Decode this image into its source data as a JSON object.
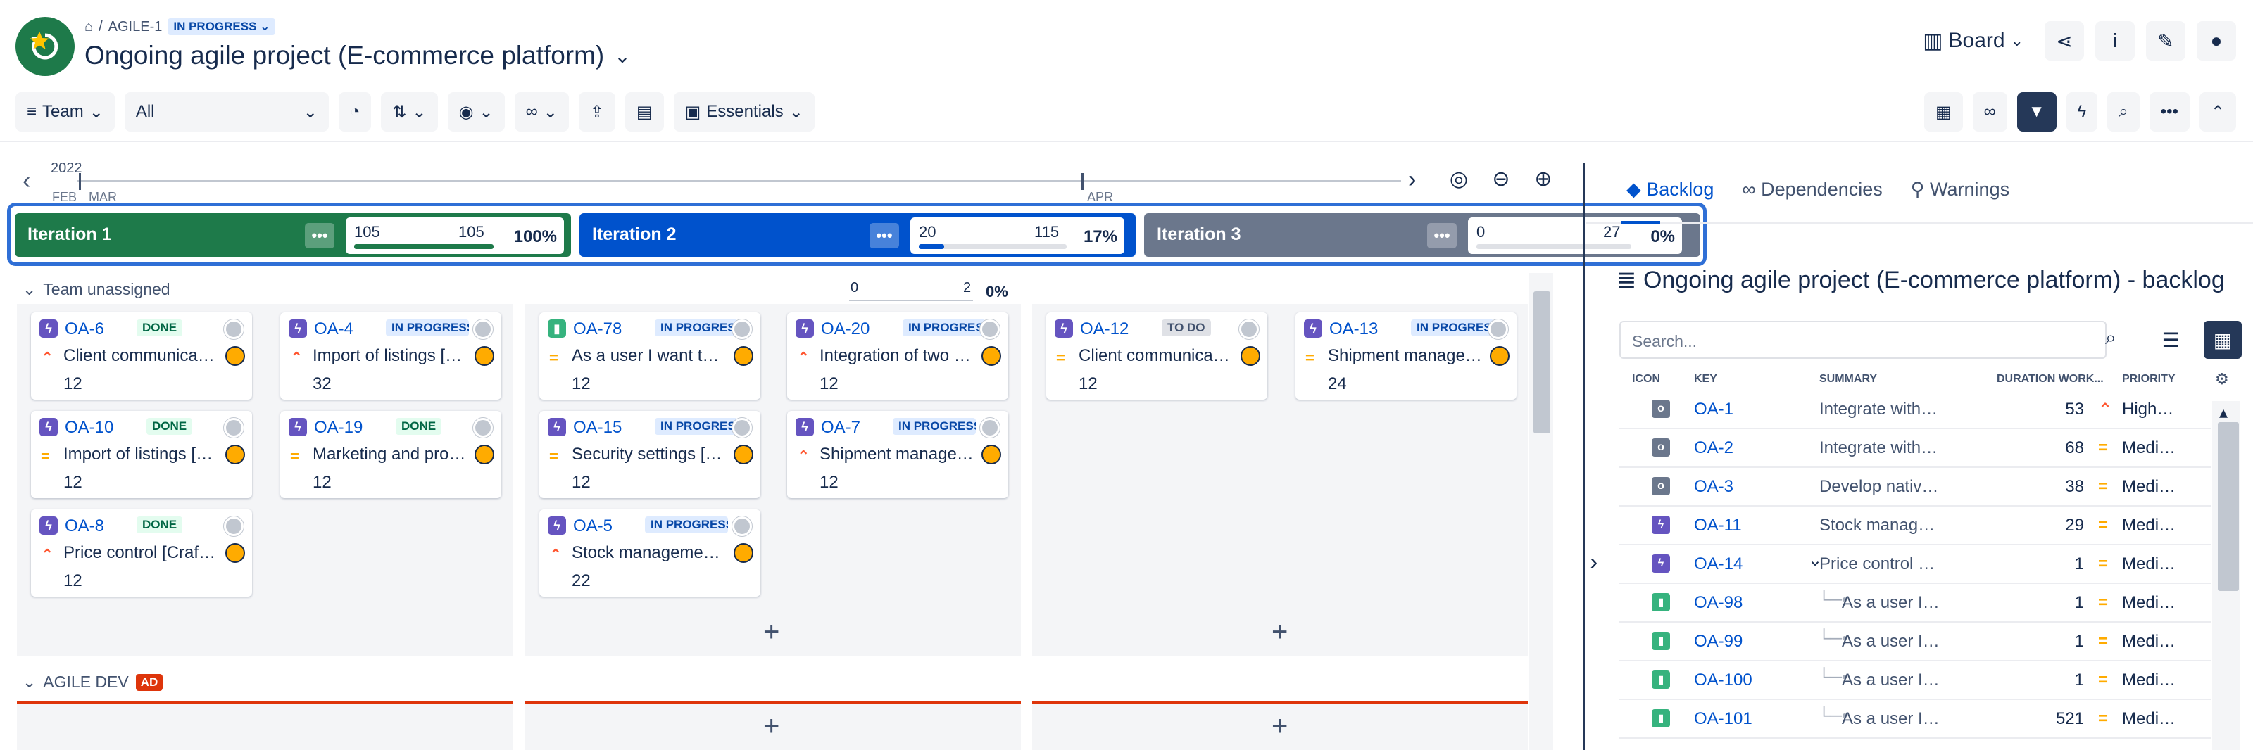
{
  "header": {
    "crumb_project": "AGILE-1",
    "status": "IN PROGRESS",
    "title": "Ongoing agile project (E-commerce platform)",
    "view_label": "Board"
  },
  "toolbar": {
    "team_label": "Team",
    "filter_value": "All",
    "essentials_label": "Essentials"
  },
  "timeline": {
    "year": "2022",
    "months": [
      "FEB",
      "MAR",
      "APR"
    ]
  },
  "iterations": [
    {
      "name": "Iteration 1",
      "done": "105",
      "total": "105",
      "percent": "100%",
      "progress": 1.0,
      "color": "#1e7a4a"
    },
    {
      "name": "Iteration 2",
      "done": "20",
      "total": "115",
      "percent": "17%",
      "progress": 0.17,
      "color": "#0052cc"
    },
    {
      "name": "Iteration 3",
      "done": "0",
      "total": "27",
      "percent": "0%",
      "progress": 0.0,
      "color": "#6b778c"
    }
  ],
  "groups": {
    "unassigned": {
      "name": "Team unassigned",
      "done": "0",
      "total": "2",
      "percent": "0%"
    },
    "agile_dev": {
      "name": "AGILE DEV",
      "badge": "AD"
    }
  },
  "cards": [
    {
      "key": "OA-6",
      "status": "DONE",
      "summary": "Client communicatio…",
      "estimate": "12",
      "priority": "high",
      "type": "story"
    },
    {
      "key": "OA-4",
      "status": "IN PROGRESS",
      "summary": "Import of listings [Cr…",
      "estimate": "32",
      "priority": "high",
      "type": "story"
    },
    {
      "key": "OA-10",
      "status": "DONE",
      "summary": "Import of listings [T…",
      "estimate": "12",
      "priority": "med",
      "type": "story"
    },
    {
      "key": "OA-19",
      "status": "DONE",
      "summary": "Marketing and prom…",
      "estimate": "12",
      "priority": "med",
      "type": "story"
    },
    {
      "key": "OA-8",
      "status": "DONE",
      "summary": "Price control [Crafts…",
      "estimate": "12",
      "priority": "high",
      "type": "story"
    },
    {
      "key": "OA-78",
      "status": "IN PROGRESS",
      "summary": "As a user I want to …",
      "estimate": "12",
      "priority": "med",
      "type": "bookmark"
    },
    {
      "key": "OA-20",
      "status": "IN PROGRESS",
      "summary": "Integration of two e-…",
      "estimate": "12",
      "priority": "high",
      "type": "story"
    },
    {
      "key": "OA-15",
      "status": "IN PROGRESS",
      "summary": "Security settings [T…",
      "estimate": "12",
      "priority": "med",
      "type": "story"
    },
    {
      "key": "OA-7",
      "status": "IN PROGRESS",
      "summary": "Shipment manage…",
      "estimate": "12",
      "priority": "high",
      "type": "story"
    },
    {
      "key": "OA-5",
      "status": "IN PROGRESS",
      "summary": "Stock management …",
      "estimate": "22",
      "priority": "high",
      "type": "story"
    },
    {
      "key": "OA-12",
      "status": "TO DO",
      "summary": "Client communicati…",
      "estimate": "12",
      "priority": "med",
      "type": "story"
    },
    {
      "key": "OA-13",
      "status": "IN PROGRESS",
      "summary": "Shipment manage…",
      "estimate": "24",
      "priority": "med",
      "type": "story"
    }
  ],
  "backlog": {
    "tabs": [
      "Backlog",
      "Dependencies",
      "Warnings"
    ],
    "title": "Ongoing agile project (E-commerce platform) - backlog",
    "search_placeholder": "Search...",
    "columns": [
      "ICON",
      "KEY",
      "SUMMARY",
      "DURATION WORK...",
      "PRIORITY"
    ],
    "rows": [
      {
        "key": "OA-1",
        "summary": "Integrate with…",
        "duration": "53",
        "priority": "High…",
        "type": "epic",
        "indent": 0
      },
      {
        "key": "OA-2",
        "summary": "Integrate with…",
        "duration": "68",
        "priority": "Medi…",
        "type": "epic",
        "indent": 0
      },
      {
        "key": "OA-3",
        "summary": "Develop nativ…",
        "duration": "38",
        "priority": "Medi…",
        "type": "epic",
        "indent": 0
      },
      {
        "key": "OA-11",
        "summary": "Stock manag…",
        "duration": "29",
        "priority": "Medi…",
        "type": "story",
        "indent": 0
      },
      {
        "key": "OA-14",
        "summary": "Price control […",
        "duration": "1",
        "priority": "Medi…",
        "type": "story",
        "indent": 0
      },
      {
        "key": "OA-98",
        "summary": "As a user I…",
        "duration": "1",
        "priority": "Medi…",
        "type": "bookmark",
        "indent": 1
      },
      {
        "key": "OA-99",
        "summary": "As a user I…",
        "duration": "1",
        "priority": "Medi…",
        "type": "bookmark",
        "indent": 1
      },
      {
        "key": "OA-100",
        "summary": "As a user I…",
        "duration": "1",
        "priority": "Medi…",
        "type": "bookmark",
        "indent": 1
      },
      {
        "key": "OA-101",
        "summary": "As a user I…",
        "duration": "521",
        "priority": "Medi…",
        "type": "bookmark",
        "indent": 1
      }
    ]
  }
}
